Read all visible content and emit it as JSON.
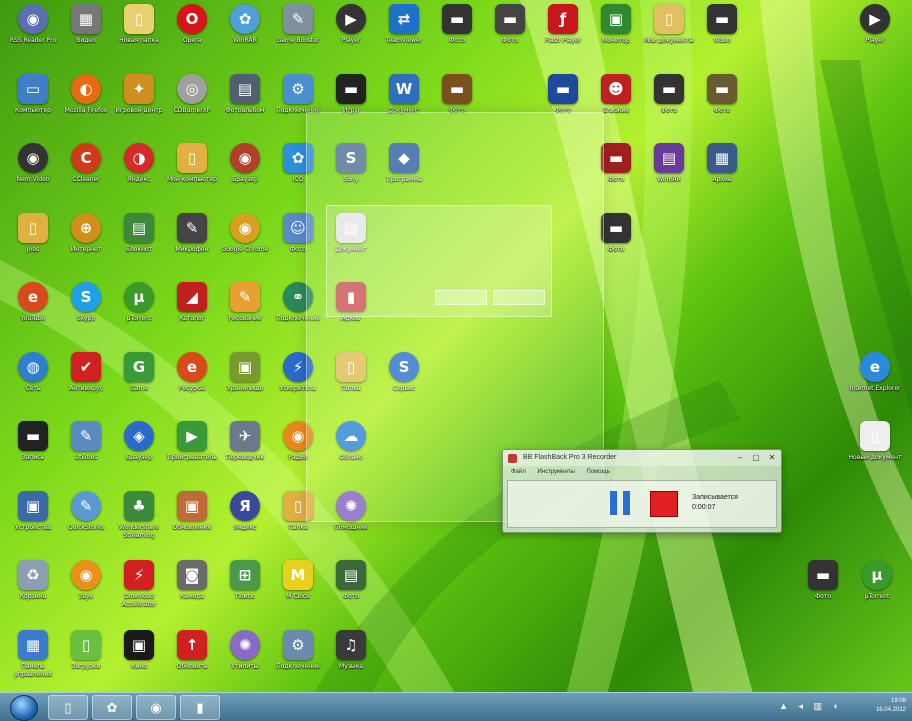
{
  "desktop": {
    "icons": [
      {
        "col": 0,
        "row": 0,
        "label": "RSS Reader Pro",
        "glyph": "◉",
        "color": "#5b6fb0",
        "round": true
      },
      {
        "col": 1,
        "row": 0,
        "label": "Видео",
        "glyph": "▦",
        "color": "#777777"
      },
      {
        "col": 2,
        "row": 0,
        "label": "Новая папка",
        "glyph": "▯",
        "color": "#e8d070"
      },
      {
        "col": 3,
        "row": 0,
        "label": "Opera",
        "glyph": "O",
        "color": "#d8141a",
        "round": true
      },
      {
        "col": 4,
        "row": 0,
        "label": "WinRAR",
        "glyph": "✿",
        "color": "#4f9fd8",
        "round": true
      },
      {
        "col": 5,
        "row": 0,
        "label": "Game Booster",
        "glyph": "✎",
        "color": "#8090a0"
      },
      {
        "col": 6,
        "row": 0,
        "label": "Player",
        "glyph": "▶",
        "color": "#333333",
        "round": true
      },
      {
        "col": 7,
        "row": 0,
        "label": "TeamViewer",
        "glyph": "⇄",
        "color": "#1d71c6"
      },
      {
        "col": 8,
        "row": 0,
        "label": "Фото",
        "glyph": "▬",
        "color": "#333333"
      },
      {
        "col": 9,
        "row": 0,
        "label": "Фото",
        "glyph": "▬",
        "color": "#444444"
      },
      {
        "col": 10,
        "row": 0,
        "label": "Flash Player",
        "glyph": "ƒ",
        "color": "#c8161d"
      },
      {
        "col": 11,
        "row": 0,
        "label": "Монитор",
        "glyph": "▣",
        "color": "#2f8a2f"
      },
      {
        "col": 12,
        "row": 0,
        "label": "Мои документы",
        "glyph": "▯",
        "color": "#e0c060"
      },
      {
        "col": 13,
        "row": 0,
        "label": "Video",
        "glyph": "▬",
        "color": "#333333"
      },
      {
        "col": 14,
        "row": 0,
        "label": "Player",
        "glyph": "▶",
        "color": "#333333",
        "round": true
      },
      {
        "col": 0,
        "row": 1,
        "label": "Компьютер",
        "glyph": "▭",
        "color": "#3f7fc8"
      },
      {
        "col": 1,
        "row": 1,
        "label": "Mozilla Firefox",
        "glyph": "◐",
        "color": "#e86a12",
        "round": true
      },
      {
        "col": 2,
        "row": 1,
        "label": "Игровой центр",
        "glyph": "✦",
        "color": "#d09020"
      },
      {
        "col": 3,
        "row": 1,
        "label": "CDBurnerXP",
        "glyph": "◎",
        "color": "#a0a0a0",
        "round": true
      },
      {
        "col": 4,
        "row": 1,
        "label": "Фотоальбом",
        "glyph": "▤",
        "color": "#506070"
      },
      {
        "col": 5,
        "row": 1,
        "label": "Подключение",
        "glyph": "⚙",
        "color": "#4a8fd0"
      },
      {
        "col": 6,
        "row": 1,
        "label": "Игры",
        "glyph": "▬",
        "color": "#222222"
      },
      {
        "col": 7,
        "row": 1,
        "label": "Документ",
        "glyph": "W",
        "color": "#2f6fc0"
      },
      {
        "col": 8,
        "row": 1,
        "label": "Фото",
        "glyph": "▬",
        "color": "#7a5020"
      },
      {
        "col": 10,
        "row": 1,
        "label": "Фото",
        "glyph": "▬",
        "color": "#1e4a9a"
      },
      {
        "col": 11,
        "row": 1,
        "label": "Близкие",
        "glyph": "☻",
        "color": "#c02020"
      },
      {
        "col": 12,
        "row": 1,
        "label": "Фото",
        "glyph": "▬",
        "color": "#333333"
      },
      {
        "col": 13,
        "row": 1,
        "label": "Фото",
        "glyph": "▬",
        "color": "#6a5a30"
      },
      {
        "col": 0,
        "row": 2,
        "label": "Nero Video",
        "glyph": "◉",
        "color": "#333333",
        "round": true
      },
      {
        "col": 1,
        "row": 2,
        "label": "CCleaner",
        "glyph": "C",
        "color": "#d03a1a",
        "round": true
      },
      {
        "col": 2,
        "row": 2,
        "label": "Яндекс",
        "glyph": "◑",
        "color": "#d42a2a",
        "round": true
      },
      {
        "col": 3,
        "row": 2,
        "label": "Мой компьютер",
        "glyph": "▯",
        "color": "#e0b040"
      },
      {
        "col": 4,
        "row": 2,
        "label": "Браузер",
        "glyph": "◉",
        "color": "#b0402a",
        "round": true
      },
      {
        "col": 5,
        "row": 2,
        "label": "ICQ",
        "glyph": "✿",
        "color": "#2f8fd8"
      },
      {
        "col": 6,
        "row": 2,
        "label": "Sony",
        "glyph": "S",
        "color": "#5a7a9a"
      },
      {
        "col": 7,
        "row": 2,
        "label": "Программа",
        "glyph": "◆",
        "color": "#3a6aa8"
      },
      {
        "col": 11,
        "row": 2,
        "label": "Фото",
        "glyph": "▬",
        "color": "#a02020"
      },
      {
        "col": 12,
        "row": 2,
        "label": "WinRAR",
        "glyph": "▤",
        "color": "#6a3a9a"
      },
      {
        "col": 13,
        "row": 2,
        "label": "Архив",
        "glyph": "▦",
        "color": "#3a5a8a"
      },
      {
        "col": 0,
        "row": 3,
        "label": "Jobs",
        "glyph": "▯",
        "color": "#e0b040"
      },
      {
        "col": 1,
        "row": 3,
        "label": "Интернет",
        "glyph": "⊕",
        "color": "#d0901a",
        "round": true
      },
      {
        "col": 2,
        "row": 3,
        "label": "Блокнот",
        "glyph": "▤",
        "color": "#3a8a3a"
      },
      {
        "col": 3,
        "row": 3,
        "label": "Микрофон",
        "glyph": "✎",
        "color": "#444444"
      },
      {
        "col": 4,
        "row": 3,
        "label": "Google Chrome",
        "glyph": "◉",
        "color": "#d8a020",
        "round": true
      },
      {
        "col": 5,
        "row": 3,
        "label": "Фото",
        "glyph": "☺",
        "color": "#5a8ac8"
      },
      {
        "col": 6,
        "row": 3,
        "label": "Документ",
        "glyph": "▤",
        "color": "#e0e0e0"
      },
      {
        "col": 11,
        "row": 3,
        "label": "Фото",
        "glyph": "▬",
        "color": "#333333"
      },
      {
        "col": 0,
        "row": 4,
        "label": "YouTube",
        "glyph": "e",
        "color": "#d84a1a",
        "round": true
      },
      {
        "col": 1,
        "row": 4,
        "label": "Skype",
        "glyph": "S",
        "color": "#1fa0e8",
        "round": true
      },
      {
        "col": 2,
        "row": 4,
        "label": "µTorrent",
        "glyph": "µ",
        "color": "#3a9a2a",
        "round": true
      },
      {
        "col": 3,
        "row": 4,
        "label": "Каталог",
        "glyph": "◢",
        "color": "#c02020"
      },
      {
        "col": 4,
        "row": 4,
        "label": "Рисование",
        "glyph": "✎",
        "color": "#e8a030"
      },
      {
        "col": 5,
        "row": 4,
        "label": "Подключение",
        "glyph": "⚭",
        "color": "#2a8a5a",
        "round": true
      },
      {
        "col": 6,
        "row": 4,
        "label": "Архив",
        "glyph": "▮",
        "color": "#c03030"
      },
      {
        "col": 0,
        "row": 5,
        "label": "Сеть",
        "glyph": "◍",
        "color": "#2f7fd0",
        "round": true
      },
      {
        "col": 1,
        "row": 5,
        "label": "Антивирус",
        "glyph": "✔",
        "color": "#d02020"
      },
      {
        "col": 2,
        "row": 5,
        "label": "Game",
        "glyph": "G",
        "color": "#3a9a3a"
      },
      {
        "col": 3,
        "row": 5,
        "label": "Ресурсы",
        "glyph": "e",
        "color": "#d84a1a",
        "round": true
      },
      {
        "col": 4,
        "row": 5,
        "label": "Хранилище",
        "glyph": "▣",
        "color": "#7a9a30"
      },
      {
        "col": 5,
        "row": 5,
        "label": "Ускоритель",
        "glyph": "⚡",
        "color": "#2a6ac8",
        "round": true
      },
      {
        "col": 6,
        "row": 5,
        "label": "Папка",
        "glyph": "▯",
        "color": "#e0c060"
      },
      {
        "col": 7,
        "row": 5,
        "label": "Сервис",
        "glyph": "S",
        "color": "#3a7ad0",
        "round": true
      },
      {
        "col": 14,
        "row": 5,
        "label": "Internet Explorer",
        "glyph": "e",
        "color": "#2a8ae0",
        "round": true
      },
      {
        "col": 0,
        "row": 6,
        "label": "Запись",
        "glyph": "▬",
        "color": "#222222"
      },
      {
        "col": 1,
        "row": 6,
        "label": "Utilities",
        "glyph": "✎",
        "color": "#5a8ac0"
      },
      {
        "col": 2,
        "row": 6,
        "label": "Браузер",
        "glyph": "◈",
        "color": "#2a6ac8",
        "round": true
      },
      {
        "col": 3,
        "row": 6,
        "label": "Проигрыватель",
        "glyph": "▶",
        "color": "#3a9a3a"
      },
      {
        "col": 4,
        "row": 6,
        "label": "Переводчик",
        "glyph": "✈",
        "color": "#6a7a8a"
      },
      {
        "col": 5,
        "row": 6,
        "label": "Радио",
        "glyph": "◉",
        "color": "#e88a1a",
        "round": true
      },
      {
        "col": 6,
        "row": 6,
        "label": "Облако",
        "glyph": "☁",
        "color": "#3a8ad8",
        "round": true
      },
      {
        "col": 14,
        "row": 6,
        "label": "Новый документ",
        "glyph": "▯",
        "color": "#eeeeee"
      },
      {
        "col": 0,
        "row": 7,
        "label": "Устройства",
        "glyph": "▣",
        "color": "#3a6aa8"
      },
      {
        "col": 1,
        "row": 7,
        "label": "QuickStores",
        "glyph": "✎",
        "color": "#5a9ad0",
        "round": true
      },
      {
        "col": 2,
        "row": 7,
        "label": "Wondershare Streaming",
        "glyph": "♣",
        "color": "#3a8a3a"
      },
      {
        "col": 3,
        "row": 7,
        "label": "Обновление",
        "glyph": "▣",
        "color": "#c06a3a"
      },
      {
        "col": 4,
        "row": 7,
        "label": "Яндекс",
        "glyph": "Я",
        "color": "#3a4a9a",
        "round": true
      },
      {
        "col": 5,
        "row": 7,
        "label": "Папка",
        "glyph": "▯",
        "color": "#e0b040"
      },
      {
        "col": 6,
        "row": 7,
        "label": "Помощник",
        "glyph": "✺",
        "color": "#8a6ac8",
        "round": true
      },
      {
        "col": 0,
        "row": 8,
        "label": "Корзина",
        "glyph": "♻",
        "color": "#8aa0b0"
      },
      {
        "col": 1,
        "row": 8,
        "label": "Звук",
        "glyph": "◉",
        "color": "#e8901a",
        "round": true
      },
      {
        "col": 2,
        "row": 8,
        "label": "Download Accelerator",
        "glyph": "⚡",
        "color": "#d02020"
      },
      {
        "col": 3,
        "row": 8,
        "label": "Камера",
        "glyph": "◙",
        "color": "#6a6a6a"
      },
      {
        "col": 4,
        "row": 8,
        "label": "Поиск",
        "glyph": "⊞",
        "color": "#4a9a4a"
      },
      {
        "col": 5,
        "row": 8,
        "label": "M Clock",
        "glyph": "M",
        "color": "#e8d020"
      },
      {
        "col": 6,
        "row": 8,
        "label": "Фото",
        "glyph": "▤",
        "color": "#3a6a3a"
      },
      {
        "col": 14,
        "row": 8,
        "label": "Фото",
        "glyph": "▬",
        "color": "#333333"
      },
      {
        "col": 15,
        "row": 8,
        "label": "µTorrent",
        "glyph": "µ",
        "color": "#3a9a2a",
        "round": true
      },
      {
        "col": 0,
        "row": 9,
        "label": "Панель управления",
        "glyph": "▦",
        "color": "#3a7ad0"
      },
      {
        "col": 1,
        "row": 9,
        "label": "Загрузки",
        "glyph": "▯",
        "color": "#6ac040"
      },
      {
        "col": 2,
        "row": 9,
        "label": "Кино",
        "glyph": "▣",
        "color": "#1a1a1a"
      },
      {
        "col": 3,
        "row": 9,
        "label": "Обновить",
        "glyph": "↑",
        "color": "#d02020"
      },
      {
        "col": 4,
        "row": 9,
        "label": "Утилиты",
        "glyph": "✺",
        "color": "#8a6ac8",
        "round": true
      },
      {
        "col": 5,
        "row": 9,
        "label": "Подключение",
        "glyph": "⚙",
        "color": "#6a8ab0"
      },
      {
        "col": 6,
        "row": 9,
        "label": "Музыка",
        "glyph": "♫",
        "color": "#3a3a3a"
      }
    ]
  },
  "recorder": {
    "title": "BB FlashBack Pro 3 Recorder",
    "menu": [
      "Файл",
      "Инструменты",
      "Помощь"
    ],
    "status_label": "Записывается",
    "elapsed": "0:00:07",
    "pause_label": "pause",
    "stop_label": "stop",
    "min_btn": "–",
    "max_btn": "▢",
    "close_btn": "✕"
  },
  "taskbar": {
    "items": [
      {
        "name": "taskbar-explorer",
        "glyph": "▯"
      },
      {
        "name": "taskbar-app",
        "glyph": "✿"
      },
      {
        "name": "taskbar-recorder",
        "glyph": "◉"
      },
      {
        "name": "taskbar-media",
        "glyph": "▮"
      }
    ],
    "tray_icons": "▲ ◂ ▥ ◖",
    "time": "19:08",
    "date": "16.04.2012"
  },
  "colors": {
    "wallpaper_accent": "#7ad81a",
    "taskbar": "#3f6f8c",
    "record_red": "#e02020",
    "pause_blue": "#2a6fd8"
  }
}
